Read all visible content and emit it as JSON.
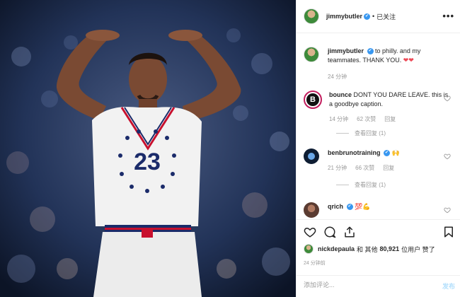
{
  "post": {
    "author": "jimmybutler",
    "follow_separator": "•",
    "follow_state": "已关注",
    "more_label": "•••",
    "photo": {
      "jersey_number": "23"
    }
  },
  "comments": [
    {
      "user": "jimmybutler",
      "verified": true,
      "text": "to philly. and my teammates. THANK YOU.",
      "emoji": "❤❤",
      "time": "24 分钟"
    },
    {
      "user": "bounce",
      "text": "DONT YOU DARE LEAVE. this is a goodbye caption.",
      "time": "14 分钟",
      "likes": "62 次赞",
      "reply": "回复",
      "view_replies": "查看回复 (1)",
      "avatar_letter": "B"
    },
    {
      "user": "benbrunotraining",
      "verified": true,
      "text": "🙌",
      "time": "21 分钟",
      "likes": "66 次赞",
      "reply": "回复",
      "view_replies": "查看回复 (1)"
    },
    {
      "user": "qrich",
      "verified": true,
      "text": "💯💪"
    }
  ],
  "likes_line": {
    "liker": "nickdepaula",
    "conj": "和 其他",
    "count": "80,921",
    "suffix": "位用户 赞了"
  },
  "timestamp": "24 分钟前",
  "add_comment": {
    "placeholder": "添加评论...",
    "post_label": "发布"
  },
  "colors": {
    "verified": "#3897f0",
    "heart": "#ed4956",
    "post_disabled": "#b2dffc",
    "border": "#efefef"
  }
}
